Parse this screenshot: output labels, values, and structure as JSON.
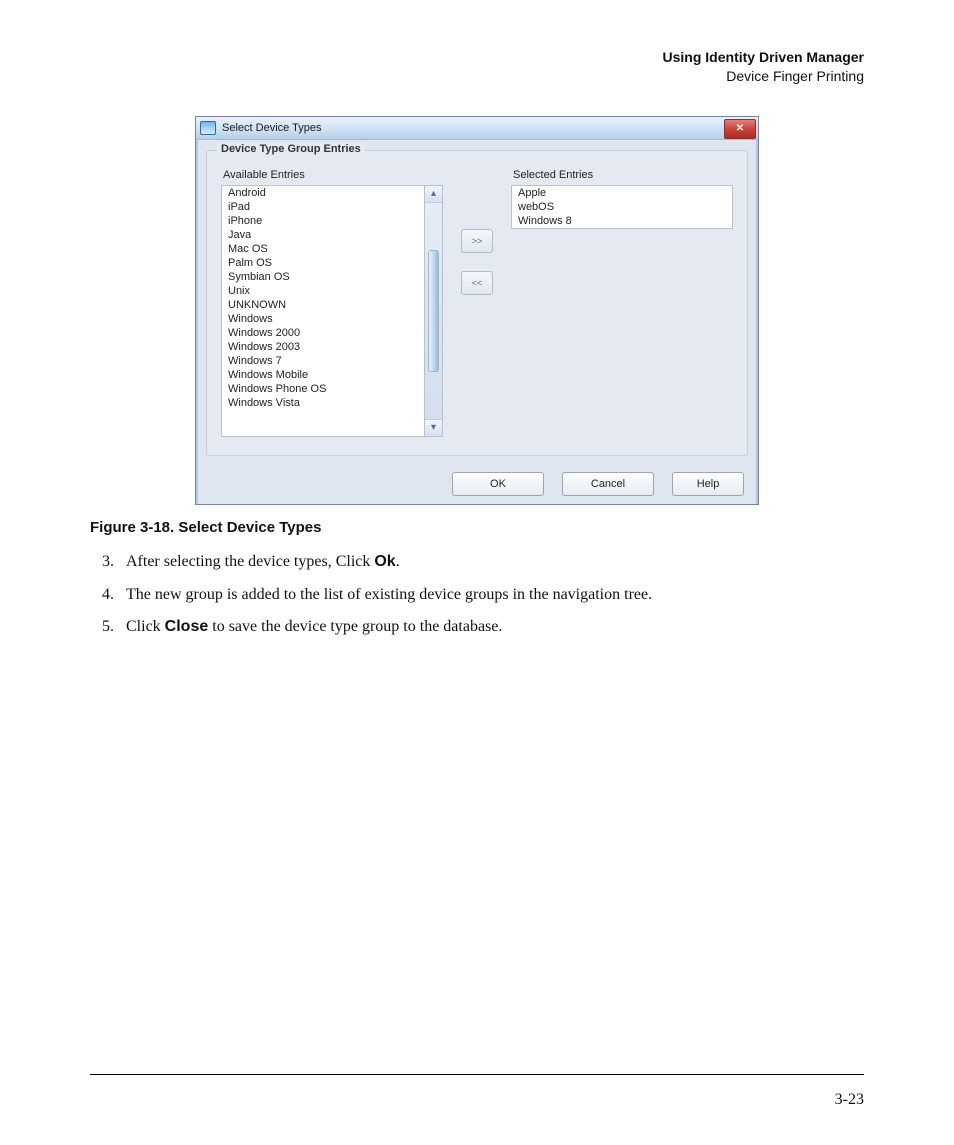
{
  "header": {
    "title": "Using Identity Driven Manager",
    "subtitle": "Device Finger Printing"
  },
  "dialog": {
    "title": "Select Device Types",
    "close_glyph": "✕",
    "group_title": "Device Type Group Entries",
    "available_label": "Available Entries",
    "selected_label": "Selected Entries",
    "available": [
      "Android",
      "iPad",
      "iPhone",
      "Java",
      "Mac OS",
      "Palm OS",
      "Symbian OS",
      "Unix",
      "UNKNOWN",
      "Windows",
      "Windows 2000",
      "Windows 2003",
      "Windows 7",
      "Windows Mobile",
      "Windows Phone OS",
      "Windows Vista"
    ],
    "selected": [
      "Apple",
      "webOS",
      "Windows 8"
    ],
    "move_right": ">>",
    "move_left": "<<",
    "scroll_up": "▴",
    "scroll_down": "▾",
    "ok": "OK",
    "cancel": "Cancel",
    "help": "Help"
  },
  "figure_caption": "Figure 3-18. Select Device Types",
  "steps": {
    "s3_a": "After selecting the device types, Click ",
    "s3_b": "Ok",
    "s3_c": ".",
    "s4": "The new group is added to the list of existing device groups in the navigation tree.",
    "s5_a": "Click ",
    "s5_b": "Close",
    "s5_c": " to save the device type group to the database."
  },
  "page_number": "3-23"
}
